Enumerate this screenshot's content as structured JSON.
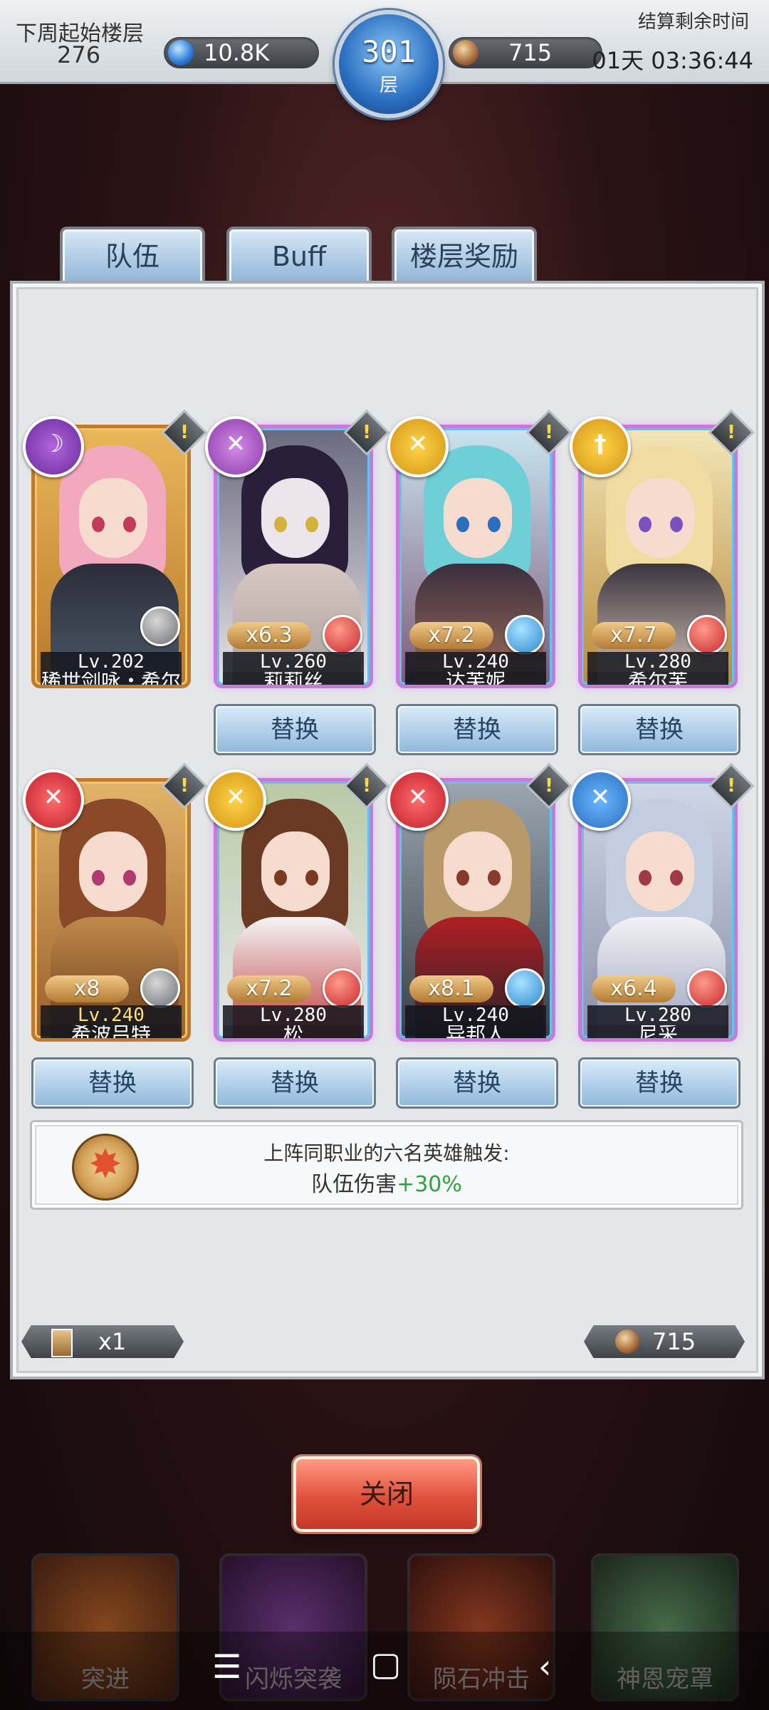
{
  "top": {
    "next_week_label": "下周起始楼层",
    "next_week_value": "276",
    "gems": "10.8K",
    "floor_number": "301",
    "floor_unit": "层",
    "medals": "715",
    "settle_label": "结算剩余时间",
    "settle_time": "01天 03:36:44"
  },
  "tabs": [
    "队伍",
    "Buff",
    "楼层奖励"
  ],
  "heroes": [
    {
      "name": "稀世剑咏・希尔",
      "level": "Lv.202",
      "mult": "",
      "element": "dark"
    },
    {
      "name": "莉莉丝",
      "level": "Lv.260",
      "mult": "x6.3",
      "element": "fire"
    },
    {
      "name": "达芙妮",
      "level": "Lv.240",
      "mult": "x7.2",
      "element": "water"
    },
    {
      "name": "希尔芙",
      "level": "Lv.280",
      "mult": "x7.7",
      "element": "fire"
    },
    {
      "name": "希波吕特",
      "level": "Lv.240",
      "mult": "x8",
      "element": "dark"
    },
    {
      "name": "松",
      "level": "Lv.280",
      "mult": "x7.2",
      "element": "fire"
    },
    {
      "name": "异邦人",
      "level": "Lv.240",
      "mult": "x8.1",
      "element": "water"
    },
    {
      "name": "尼采",
      "level": "Lv.280",
      "mult": "x6.4",
      "element": "fire"
    }
  ],
  "swap_label": "替换",
  "bonus": {
    "line1": "上阵同职业的六名英雄触发:",
    "line2_prefix": "队伍伤害",
    "line2_value": "+30%"
  },
  "footer": {
    "ticket_count": "x1",
    "medal_count": "715"
  },
  "close_label": "关闭",
  "skills": [
    "突进",
    "闪烁突袭",
    "陨石冲击",
    "神恩宠罩"
  ],
  "colors": {
    "accent_blue": "#2a6fc1",
    "bonus_green": "#2ea33a",
    "close_red": "#e0503c"
  }
}
